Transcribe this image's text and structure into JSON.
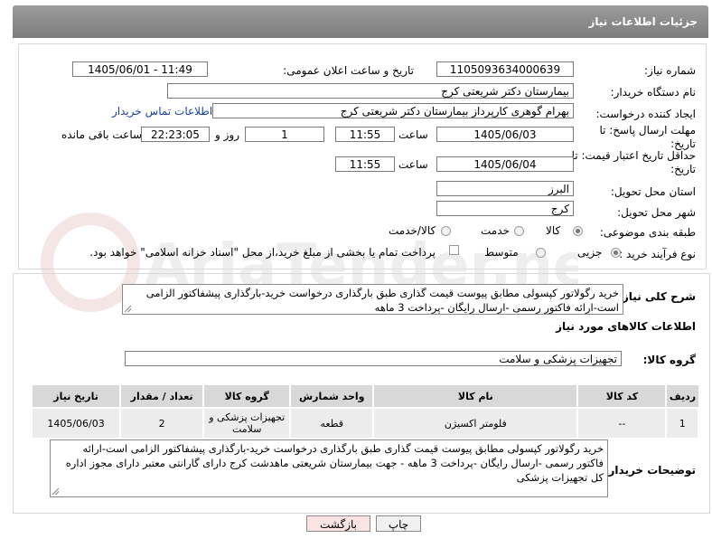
{
  "header": {
    "title": "جزئیات اطلاعات نیاز"
  },
  "need_number": {
    "label": "شماره نیاز:",
    "value": "1105093634000639"
  },
  "announce_datetime": {
    "label": "تاریخ و ساعت اعلان عمومی:",
    "value": "1405/06/01 - 11:49"
  },
  "buyer_org": {
    "label": "نام دستگاه خریدار:",
    "value": "بیمارستان دکتر شریعتی کرج"
  },
  "requester": {
    "label": "ایجاد کننده درخواست:",
    "value": "بهرام گوهری کارپرداز بیمارستان دکتر شریعتی کرج",
    "contact_link": "اطلاعات تماس خریدار"
  },
  "reply_deadline": {
    "label": "مهلت ارسال پاسخ: تا تاریخ:",
    "date": "1405/06/03",
    "time_label": "ساعت",
    "time": "11:55",
    "days": "1",
    "days_label": "روز و",
    "remaining": "22:23:05",
    "remaining_label": "ساعت باقی مانده"
  },
  "price_validity": {
    "label": "حداقل تاریخ اعتبار قیمت: تا تاریخ:",
    "date": "1405/06/04",
    "time_label": "ساعت",
    "time": "11:55"
  },
  "province": {
    "label": "استان محل تحویل:",
    "value": "البرز"
  },
  "city": {
    "label": "شهر محل تحویل:",
    "value": "کرج"
  },
  "category": {
    "label": "طبقه بندی موضوعی:",
    "options": [
      "کالا",
      "خدمت",
      "کالا/خدمت"
    ],
    "selected": "کالا"
  },
  "purchase_process": {
    "label": "نوع فرآیند خرید :",
    "options": [
      "جزیی",
      "متوسط"
    ],
    "selected": "جزیی",
    "checkbox_text": "پرداخت تمام یا بخشی از مبلغ خرید،از محل \"اسناد خزانه اسلامی\" خواهد بود."
  },
  "description": {
    "label": "شرح کلی نیاز:",
    "value": "خرید رگولاتور کپسولی مطابق پیوست   قیمت گذاری طبق بارگذاری درخواست خرید-بارگذاری پیشفاکتور الزامی است-ارائه فاکتور رسمی -ارسال رایگان -پرداخت 3 ماهه"
  },
  "goods_info": {
    "title": "اطلاعات کالاهای مورد نیاز"
  },
  "goods_group": {
    "label": "گروه کالا:",
    "value": "تجهیزات پزشکی و سلامت"
  },
  "table": {
    "headers": [
      "ردیف",
      "کد کالا",
      "نام کالا",
      "واحد شمارش",
      "گروه کالا",
      "تعداد / مقدار",
      "تاریخ نیاز"
    ],
    "rows": [
      [
        "1",
        "--",
        "فلومتر اکسیژن",
        "قطعه",
        "تجهیزات پزشکی و سلامت",
        "2",
        "1405/06/03"
      ]
    ]
  },
  "buyer_notes": {
    "label": "توضیحات خریدار:",
    "value": "خرید رگولاتور کپسولی مطابق پیوست   قیمت گذاری طبق بارگذاری درخواست خرید-بارگذاری پیشفاکتور الزامی است-ارائه فاکتور رسمی -ارسال رایگان -پرداخت 3 ماهه - جهت بیمارستان شریعتی ماهدشت کرج دارای گارانتی معتبر دارای مجوز اداره کل تجهیزات پزشکی"
  },
  "buttons": {
    "print": "چاپ",
    "back": "بازگشت"
  },
  "colors": {
    "header_bg": "#8a8a8a",
    "link": "#1a3fa8",
    "back_bg": "#fbe3e3",
    "print_bg": "#f0f0f0"
  }
}
